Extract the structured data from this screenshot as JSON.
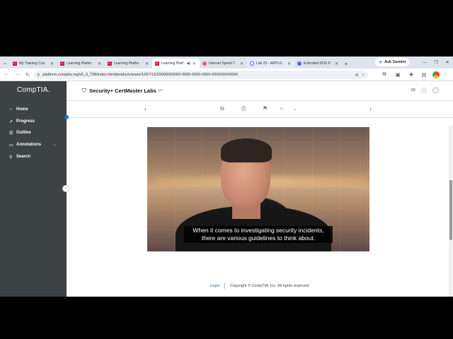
{
  "browser": {
    "tabs": [
      {
        "label": "My Training Cou",
        "favicon": "comptia-icon",
        "active": false
      },
      {
        "label": "Learning Platfor",
        "favicon": "comptia-icon",
        "active": false
      },
      {
        "label": "Learning Platfor",
        "favicon": "comptia-icon",
        "active": false
      },
      {
        "label": "Learning Platf",
        "favicon": "comptia-icon",
        "active": true,
        "audio": true
      },
      {
        "label": "Internet Speed T",
        "favicon": "gauge-icon",
        "active": false
      },
      {
        "label": "Lab 25 - APPLIC",
        "favicon": "ring-icon",
        "active": false
      },
      {
        "label": "Extended DOS P",
        "favicon": "globe-icon",
        "active": false
      }
    ],
    "ask_gemini": "Ask Gemini",
    "url": "platform.comptia.org/v6_0_738/index.html/productviewer/1267/12/20000000000-0000-0000-0000-000000000000",
    "new_tab": "+"
  },
  "sidebar": {
    "logo": "CompTIA.",
    "items": [
      {
        "label": "Home",
        "icon": "home-icon"
      },
      {
        "label": "Progress",
        "icon": "chart-icon"
      },
      {
        "label": "Outline",
        "icon": "list-icon"
      },
      {
        "label": "Annotations",
        "icon": "annotation-icon"
      },
      {
        "label": "Search",
        "icon": "search-icon"
      }
    ]
  },
  "header": {
    "title": "Security+ CertMaster Labs",
    "version": "V7"
  },
  "video": {
    "caption_line1": "When it comes to investigating security incidents,",
    "caption_line2": "there are various guidelines to think about."
  },
  "footer": {
    "legal": "Legal",
    "copyright": "Copyright © CompTIA, Inc. All rights reserved."
  },
  "colors": {
    "sidebar_bg": "#3d4245",
    "accent": "#2a6fb8",
    "brand_red": "#c8102e"
  }
}
